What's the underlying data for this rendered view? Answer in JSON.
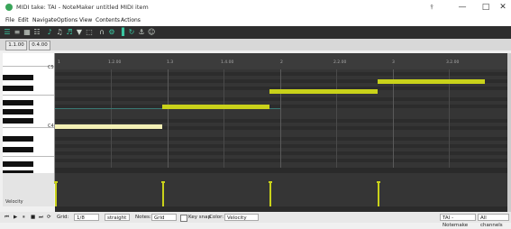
{
  "window": {
    "title": "MIDI take: TAI - NoteMaker untitled MIDI item",
    "pin_icon": "pin-icon",
    "min_label": "—",
    "max_label": "□",
    "close_label": "✕"
  },
  "menu": [
    "File",
    "Edit",
    "Navigate",
    "Options",
    "View",
    "Contents",
    "Actions"
  ],
  "toolbar_icons": [
    {
      "name": "piano-roll-icon",
      "glyph": "☰",
      "on": true
    },
    {
      "name": "list-icon",
      "glyph": "≡",
      "on": false
    },
    {
      "name": "grid-icon",
      "glyph": "▦",
      "on": false
    },
    {
      "name": "keyboard-icon",
      "glyph": "☷",
      "on": false
    },
    {
      "name": "note-pencil-icon",
      "glyph": "♪",
      "on": true
    },
    {
      "name": "note-erase-icon",
      "glyph": "♫",
      "on": false
    },
    {
      "name": "step-icon",
      "glyph": "♬",
      "on": true
    },
    {
      "name": "filter-icon",
      "glyph": "▼",
      "on": false
    },
    {
      "name": "marquee-icon",
      "glyph": "⬚",
      "on": false
    },
    {
      "name": "magnet-icon",
      "glyph": "∩",
      "on": false
    },
    {
      "name": "snap-icon",
      "glyph": "⚙",
      "on": true
    },
    {
      "name": "quantize-icon",
      "glyph": "▐",
      "on": true
    },
    {
      "name": "loop-icon",
      "glyph": "↻",
      "on": true
    },
    {
      "name": "metronome-icon",
      "glyph": "⚓",
      "on": false
    },
    {
      "name": "ghost-icon",
      "glyph": "☺",
      "on": false
    }
  ],
  "position": {
    "start": "1.1.00",
    "length": "0.4.00"
  },
  "keyboard_labels": {
    "c5": "C5",
    "c4": "C4"
  },
  "ruler_labels": [
    "1",
    "1.2.00",
    "1.3",
    "1.4.00",
    "2",
    "2.2.00",
    "3",
    "3.2.00"
  ],
  "cc_lane_label": "Velocity",
  "notes": [
    {
      "start": 0.0,
      "end": 0.25,
      "pitch": 60,
      "color": "#f3f0b5"
    },
    {
      "start": 0.25,
      "end": 0.5,
      "pitch": 64,
      "color": "#c9d21a"
    },
    {
      "start": 0.5,
      "end": 0.75,
      "pitch": 67,
      "color": "#c9d21a"
    },
    {
      "start": 0.75,
      "end": 1.0,
      "pitch": 69,
      "color": "#c9d21a"
    }
  ],
  "velocities": [
    {
      "pos": 0.0,
      "value": 96
    },
    {
      "pos": 0.25,
      "value": 96
    },
    {
      "pos": 0.5,
      "value": 96
    },
    {
      "pos": 0.75,
      "value": 96
    }
  ],
  "bottom": {
    "grid_label": "Grid:",
    "grid_value": "1/8",
    "straight_value": "straight",
    "notes_label": "Notes:",
    "notes_value": "Grid",
    "keysnap_label": "Key snap",
    "color_label": "Color:",
    "color_value": "Velocity",
    "channel_value": "TAI - Notemake",
    "allchannels_value": "All channels"
  },
  "colors": {
    "accent": "#39c6a0",
    "note": "#c9d21a",
    "note_selected": "#f3f0b5"
  }
}
